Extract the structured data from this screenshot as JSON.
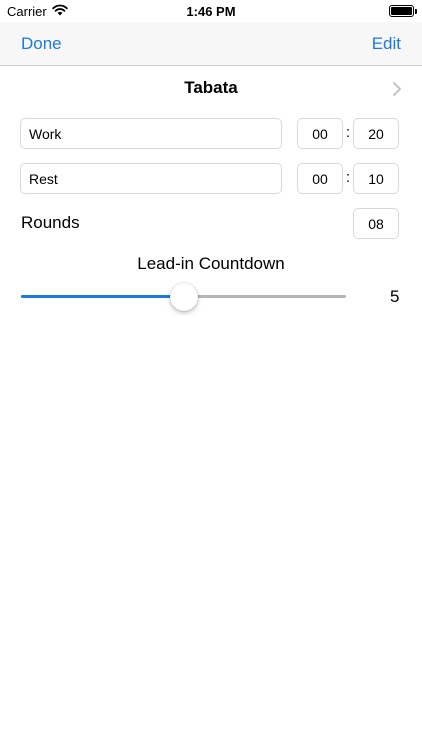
{
  "status_bar": {
    "carrier": "Carrier",
    "time": "1:46 PM"
  },
  "nav": {
    "left_button": "Done",
    "right_button": "Edit"
  },
  "workout": {
    "title": "Tabata",
    "intervals": [
      {
        "name": "Work",
        "minutes": "00",
        "seconds": "20"
      },
      {
        "name": "Rest",
        "minutes": "00",
        "seconds": "10"
      }
    ],
    "rounds_label": "Rounds",
    "rounds_value": "08",
    "colon": ":"
  },
  "lead_in": {
    "label": "Lead-in Countdown",
    "value": "5",
    "slider_fraction": 0.5
  },
  "colors": {
    "accent": "#1a7ae0",
    "track": "#b5b5b5"
  }
}
